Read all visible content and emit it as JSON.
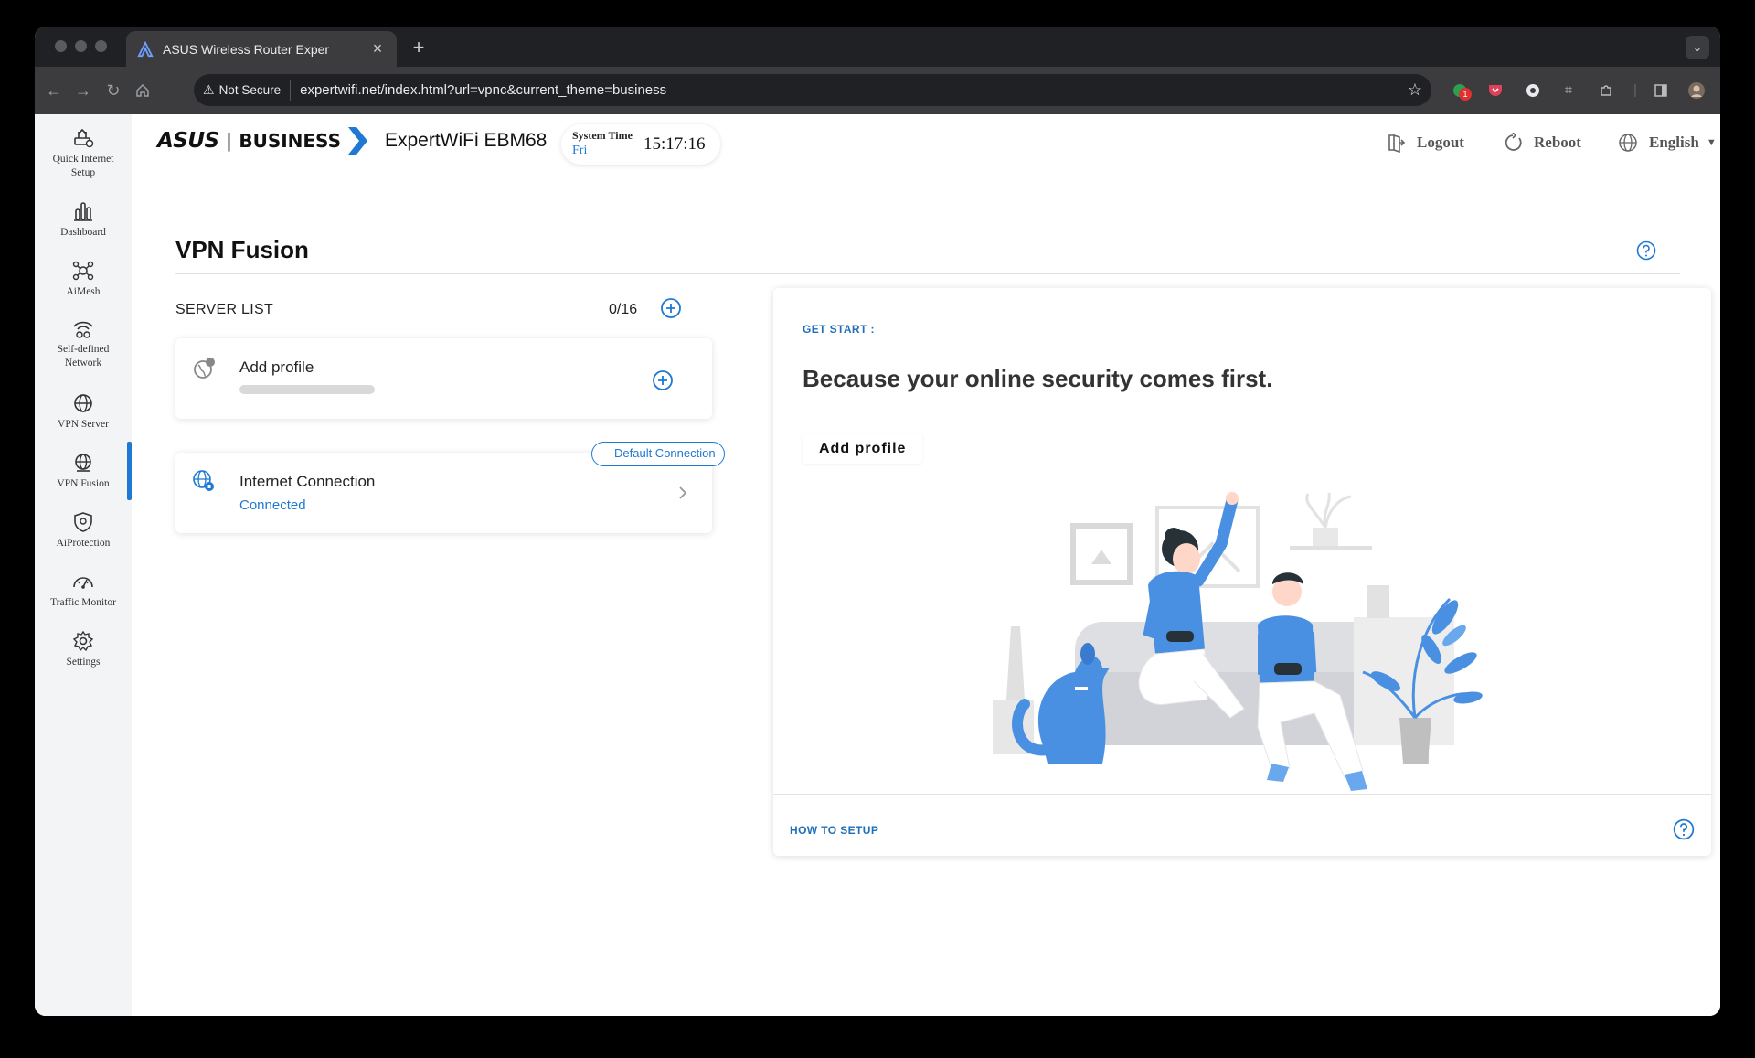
{
  "browser": {
    "tab_title": "ASUS Wireless Router Exper",
    "new_tab": "+",
    "security_label": "Not Secure",
    "url": "expertwifi.net/index.html?url=vpnc&current_theme=business",
    "extension_badge": "1"
  },
  "brand": {
    "logo": "ASUS",
    "separator": "|",
    "line": "BUSINESS",
    "model": "ExpertWiFi EBM68"
  },
  "system_time": {
    "label": "System Time",
    "day": "Fri",
    "time": "15:17:16"
  },
  "header_actions": {
    "logout": "Logout",
    "reboot": "Reboot",
    "language": "English"
  },
  "sidebar": {
    "items": [
      {
        "label_1": "Quick Internet",
        "label_2": "Setup",
        "icon": "quick-setup-icon"
      },
      {
        "label_1": "Dashboard",
        "icon": "dashboard-icon"
      },
      {
        "label_1": "AiMesh",
        "icon": "aimesh-icon"
      },
      {
        "label_1": "Self-defined",
        "label_2": "Network",
        "icon": "sdn-icon"
      },
      {
        "label_1": "VPN Server",
        "icon": "vpn-server-icon"
      },
      {
        "label_1": "VPN Fusion",
        "icon": "vpn-fusion-icon",
        "active": true
      },
      {
        "label_1": "AiProtection",
        "icon": "aiprotection-icon"
      },
      {
        "label_1": "Traffic Monitor",
        "icon": "traffic-monitor-icon"
      },
      {
        "label_1": "Settings",
        "icon": "settings-icon"
      }
    ]
  },
  "page": {
    "title": "VPN Fusion"
  },
  "server_list": {
    "label": "SERVER LIST",
    "count": "0/16",
    "add_profile": {
      "title": "Add profile"
    },
    "internet": {
      "badge": "Default Connection",
      "title": "Internet Connection",
      "status": "Connected"
    }
  },
  "get_start": {
    "label": "GET START :",
    "headline": "Because your online security comes first.",
    "button": "Add profile",
    "how_to": "HOW TO SETUP"
  },
  "colors": {
    "accent": "#1f78d1",
    "illustration_blue": "#4a90e2"
  }
}
